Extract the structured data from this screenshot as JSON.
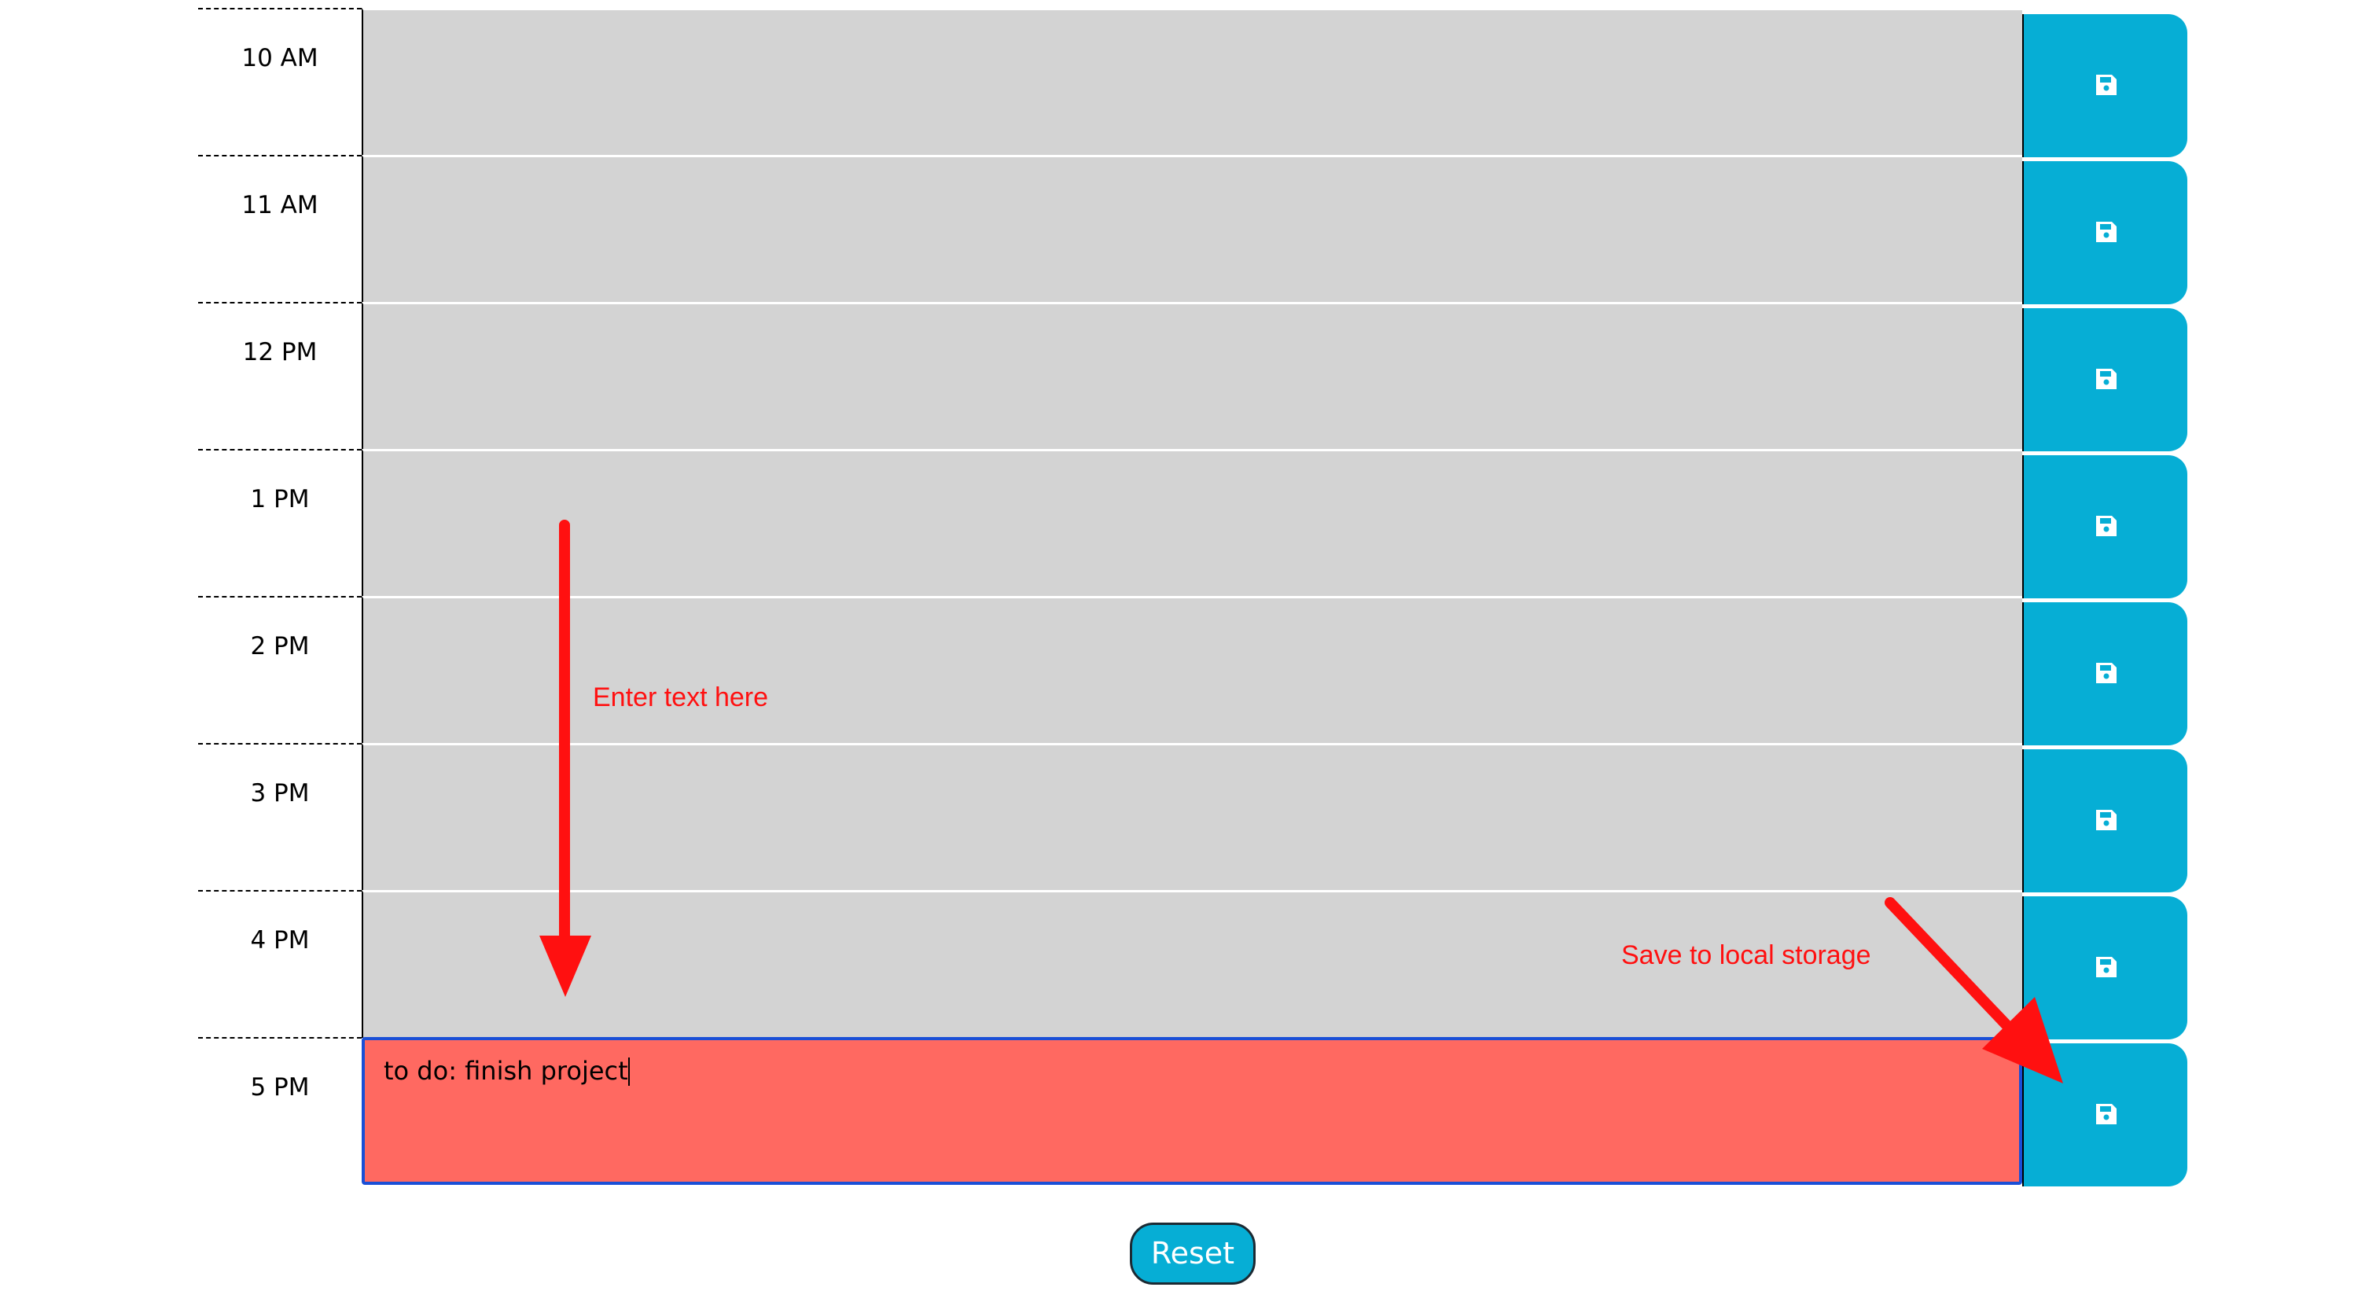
{
  "schedule": {
    "rows": [
      {
        "hour": "10 AM",
        "text": ""
      },
      {
        "hour": "11 AM",
        "text": ""
      },
      {
        "hour": "12 PM",
        "text": ""
      },
      {
        "hour": "1 PM",
        "text": ""
      },
      {
        "hour": "2 PM",
        "text": ""
      },
      {
        "hour": "3 PM",
        "text": ""
      },
      {
        "hour": "4 PM",
        "text": ""
      },
      {
        "hour": "5 PM",
        "text": "to do: finish project"
      }
    ],
    "save_icon": "floppy-disk-icon",
    "current_hour_index": 7
  },
  "reset_label": "Reset",
  "annotations": {
    "enter_text": "Enter text here",
    "save_local": "Save to local storage"
  },
  "colors": {
    "past_row": "#d3d3d3",
    "present_row": "#ff6961",
    "save_button": "#06aed5",
    "annotation": "#ff1010"
  }
}
